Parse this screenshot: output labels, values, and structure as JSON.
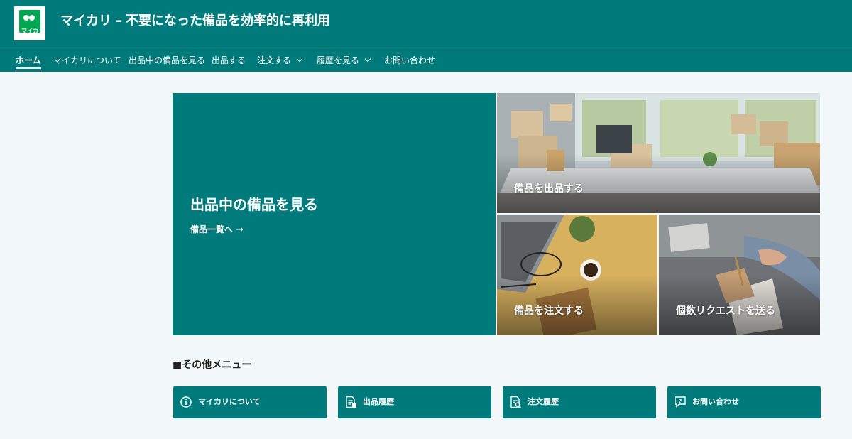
{
  "header": {
    "logo_text": "マイカリ",
    "title": "マイカリ - 不要になった備品を効率的に再利用"
  },
  "nav": {
    "items": [
      {
        "label": "ホーム",
        "active": true
      },
      {
        "label": "マイカリについて"
      },
      {
        "label": "出品中の備品を見る"
      },
      {
        "label": "出品する"
      },
      {
        "label": "注文する",
        "dropdown": true
      },
      {
        "label": "履歴を見る",
        "dropdown": true
      },
      {
        "label": "お問い合わせ"
      }
    ]
  },
  "hero": {
    "title": "出品中の備品を見る",
    "link": "備品一覧へ",
    "link_icon": "arrow-right-icon"
  },
  "tiles": [
    {
      "label": "備品を出品する"
    },
    {
      "label": "備品を注文する"
    },
    {
      "label": "個数リクエストを送る"
    }
  ],
  "other_menu": {
    "title": "■その他メニュー",
    "buttons": [
      {
        "label": "マイカリについて",
        "icon": "info-icon"
      },
      {
        "label": "出品履歴",
        "icon": "document-list-icon"
      },
      {
        "label": "注文履歴",
        "icon": "document-search-icon"
      },
      {
        "label": "お問い合わせ",
        "icon": "chat-question-icon"
      }
    ]
  },
  "colors": {
    "brand": "#007a7a",
    "logo_green": "#00a651",
    "background": "#f2f8f9"
  }
}
